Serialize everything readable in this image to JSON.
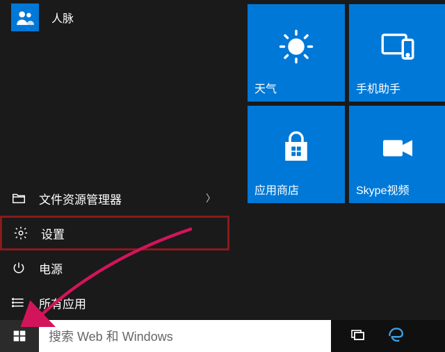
{
  "apps": {
    "people": "人脉"
  },
  "menu": {
    "file_explorer": "文件资源管理器",
    "settings": "设置",
    "power": "电源",
    "all_apps": "所有应用"
  },
  "tiles": {
    "weather": "天气",
    "phone_companion": "手机助手",
    "store": "应用商店",
    "skype_video": "Skype视频"
  },
  "taskbar": {
    "search_placeholder": "搜索 Web 和 Windows"
  },
  "colors": {
    "accent": "#0078d7",
    "highlight_border": "#8b1a1a"
  }
}
